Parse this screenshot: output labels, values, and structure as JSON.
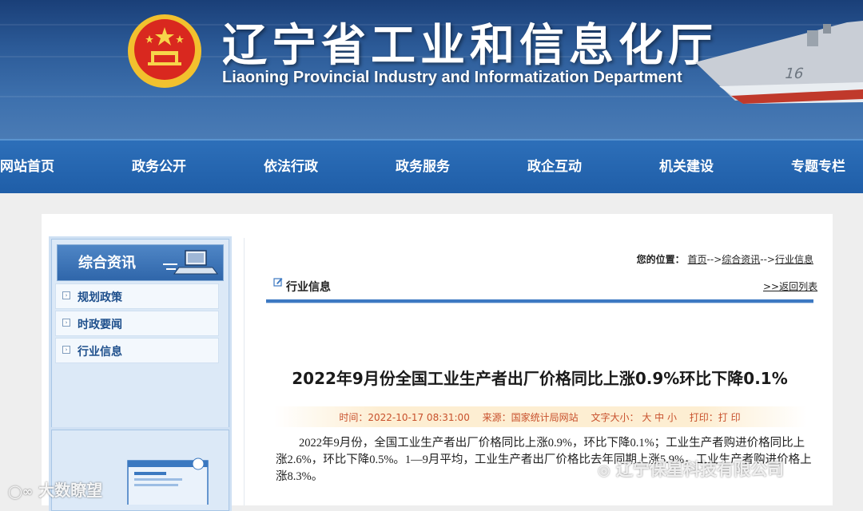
{
  "header": {
    "title_cn": "辽宁省工业和信息化厅",
    "title_en": "Liaoning Provincial Industry and Informatization Department"
  },
  "nav": {
    "items": [
      "网站首页",
      "政务公开",
      "依法行政",
      "政务服务",
      "政企互动",
      "机关建设",
      "专题专栏"
    ]
  },
  "sidebar": {
    "heading": "综合资讯",
    "items": [
      "规划政策",
      "时政要闻",
      "行业信息"
    ]
  },
  "breadcrumb": {
    "label": "您的位置：",
    "items": [
      "首页",
      "综合资讯",
      "行业信息"
    ],
    "separator": "-->"
  },
  "section": {
    "title": "行业信息",
    "back_link": ">>返回列表"
  },
  "article": {
    "title": "2022年9月份全国工业生产者出厂价格同比上涨0.9%环比下降0.1%",
    "meta_time": "时间：2022-10-17 08:31:00",
    "meta_source": "来源：国家统计局网站",
    "meta_font": "文字大小： 大 中 小",
    "meta_print": "打印：打 印",
    "body": "2022年9月份，全国工业生产者出厂价格同比上涨0.9%，环比下降0.1%；工业生产者购进价格同比上涨2.6%，环比下降0.5%。1—9月平均，工业生产者出厂价格比去年同期上涨5.9%，工业生产者购进价格上涨8.3%。"
  },
  "watermarks": {
    "left": "大数瞭望",
    "right": "辽宁保星科技有限公司"
  },
  "colors": {
    "banner": "#2c5b98",
    "nav": "#2468b2",
    "accent": "#3d79c2",
    "meta": "#c8502c"
  }
}
